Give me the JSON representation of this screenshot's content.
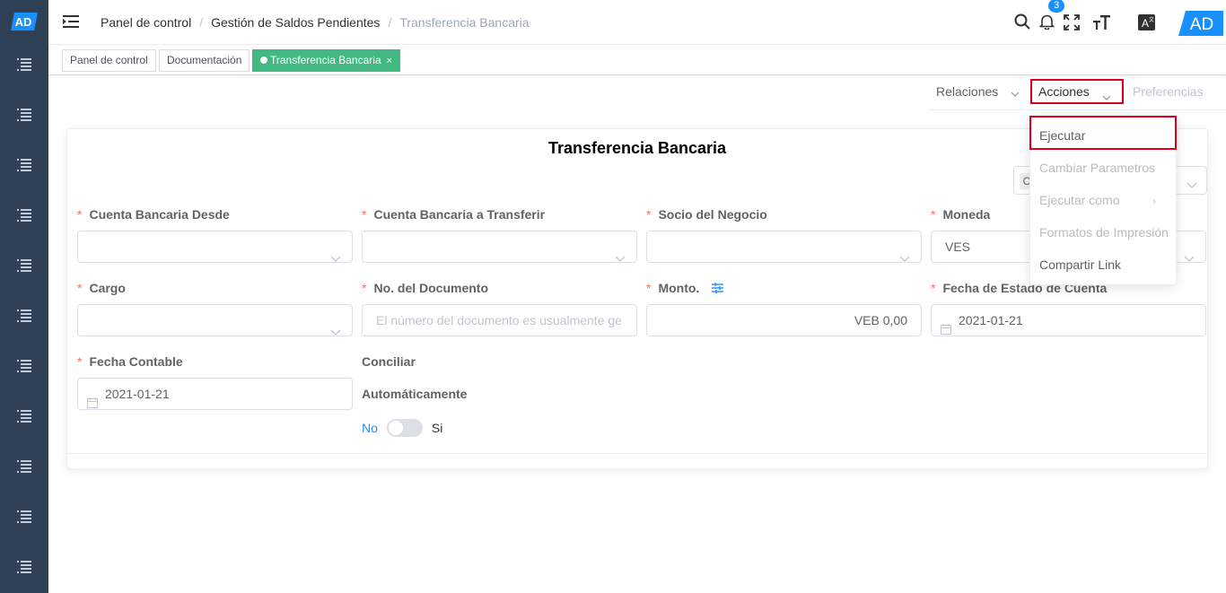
{
  "app": {
    "logo_text": "AD",
    "avatar_text": "AD",
    "notification_count": "3"
  },
  "sidebar": {
    "items": [
      "menu-1",
      "menu-2",
      "menu-3",
      "menu-4",
      "menu-5",
      "menu-6",
      "menu-7",
      "menu-8",
      "menu-9",
      "menu-10",
      "menu-11"
    ]
  },
  "breadcrumb": {
    "items": [
      {
        "label": "Panel de control"
      },
      {
        "label": "Gestión de Saldos Pendientes"
      },
      {
        "label": "Transferencia Bancaria"
      }
    ],
    "separator": "/"
  },
  "tags": {
    "items": [
      {
        "label": "Panel de control"
      },
      {
        "label": "Documentación"
      },
      {
        "label": "Transferencia Bancaria",
        "close": "×"
      }
    ]
  },
  "toolbar": {
    "relaciones": "Relaciones",
    "acciones": "Acciones",
    "preferencias": "Preferencias"
  },
  "form": {
    "title": "Transferencia Bancaria",
    "required_mark": "*",
    "fields": {
      "cuenta_desde": {
        "label": "Cuenta Bancaria Desde",
        "value": ""
      },
      "cuenta_transferir": {
        "label": "Cuenta Bancaria a Transferir",
        "value": ""
      },
      "socio": {
        "label": "Socio del Negocio",
        "value": ""
      },
      "moneda": {
        "label": "Moneda",
        "value": "VES"
      },
      "cargo": {
        "label": "Cargo",
        "value": ""
      },
      "no_documento": {
        "label": "No. del Documento",
        "placeholder": "El número del documento es usualmente ge"
      },
      "monto": {
        "label": "Monto.",
        "value": "VEB 0,00"
      },
      "fecha_estado": {
        "label": "Fecha de Estado de Cuenta",
        "value": "2021-01-21"
      },
      "fecha_contable": {
        "label": "Fecha Contable",
        "value": "2021-01-21"
      },
      "conciliar": {
        "label_line1": "Conciliar",
        "label_line2": "Automáticamente",
        "off": "No",
        "on": "Si"
      }
    }
  },
  "dropdown": {
    "items": [
      {
        "label": "Ejecutar",
        "disabled": false
      },
      {
        "label": "Cambiar Parametros",
        "disabled": true
      },
      {
        "label": "Ejecutar como",
        "disabled": true
      },
      {
        "label": "Formatos de Impresión",
        "disabled": true
      },
      {
        "label": "Compartir Link",
        "disabled": false
      }
    ]
  },
  "colors": {
    "sidebar": "#304156",
    "accent": "#1890ff",
    "tag_active": "#42b983",
    "required": "#f56c6c",
    "highlight": "#d9001b"
  }
}
